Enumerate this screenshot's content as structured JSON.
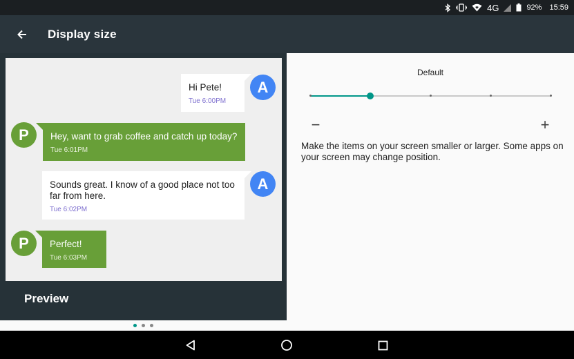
{
  "status_bar": {
    "network": "4G",
    "battery": "92%",
    "time": "15:59",
    "icons": [
      "bluetooth-icon",
      "vibrate-icon",
      "wifi-icon",
      "signal-icon",
      "battery-icon"
    ]
  },
  "app_bar": {
    "back_icon": "arrow-back-icon",
    "title": "Display size"
  },
  "preview": {
    "label": "Preview",
    "messages": [
      {
        "sender": "A",
        "direction": "out",
        "text": "Hi Pete!",
        "time": "Tue 6:00PM"
      },
      {
        "sender": "P",
        "direction": "in",
        "text": "Hey, want to grab coffee and catch up today?",
        "time": "Tue 6:01PM"
      },
      {
        "sender": "A",
        "direction": "out",
        "text": "Sounds great. I know of a good place not too far from here.",
        "time": "Tue 6:02PM"
      },
      {
        "sender": "P",
        "direction": "in",
        "text": "Perfect!",
        "time": "Tue 6:03PM"
      }
    ],
    "page_dots": {
      "count": 3,
      "active_index": 0
    }
  },
  "settings": {
    "current_size_label": "Default",
    "slider": {
      "steps": 5,
      "selected_index": 1
    },
    "minus_label": "−",
    "plus_label": "+",
    "description": "Make the items on your screen smaller or larger. Some apps on your screen may change position."
  },
  "nav_bar": {
    "icons": [
      "back-triangle-icon",
      "home-circle-icon",
      "recents-square-icon"
    ]
  },
  "colors": {
    "accent": "#009688",
    "avatar_a": "#4285f4",
    "avatar_p": "#689f38",
    "app_bar": "#2a353c"
  }
}
